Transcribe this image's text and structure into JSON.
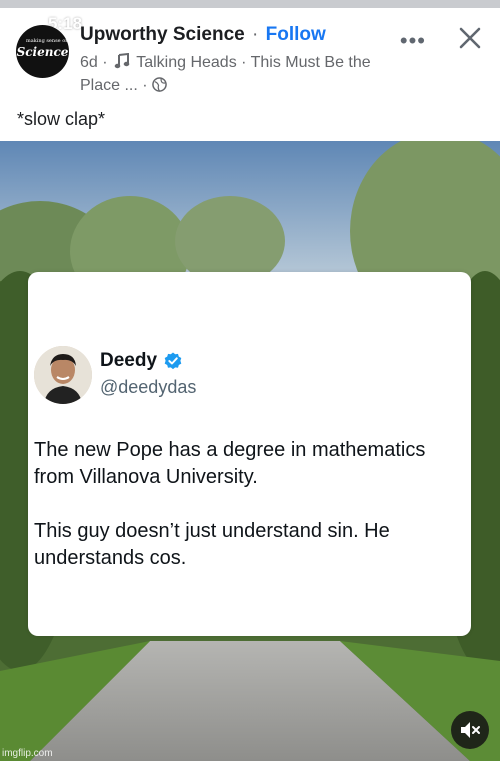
{
  "status_bar": {
    "time": "5:18"
  },
  "post": {
    "page_name": "Upworthy Science",
    "separator": "·",
    "follow_label": "Follow",
    "age": "6d",
    "song_artist": "Talking Heads",
    "song_title": "This Must Be the Place ...",
    "logo_text": "Science",
    "logo_small_text": "making sense of",
    "caption": "*slow clap*"
  },
  "tweet": {
    "name": "Deedy",
    "handle": "@deedydas",
    "paragraph_1": "The new Pope has a degree in mathematics from Villanova University.",
    "paragraph_2": "This guy doesn’t just understand sin. He understands cos."
  },
  "watermark": "imgflip.com",
  "icons": {
    "signal": "wifi-icon",
    "battery": "battery-icon",
    "music": "music-note-icon",
    "audience": "globe-icon",
    "verified": "verified-badge-icon",
    "close": "close-icon",
    "more": "more-options-icon",
    "mute": "speaker-muted-icon"
  },
  "colors": {
    "follow": "#1877f2",
    "verified": "#1d9bf0"
  }
}
